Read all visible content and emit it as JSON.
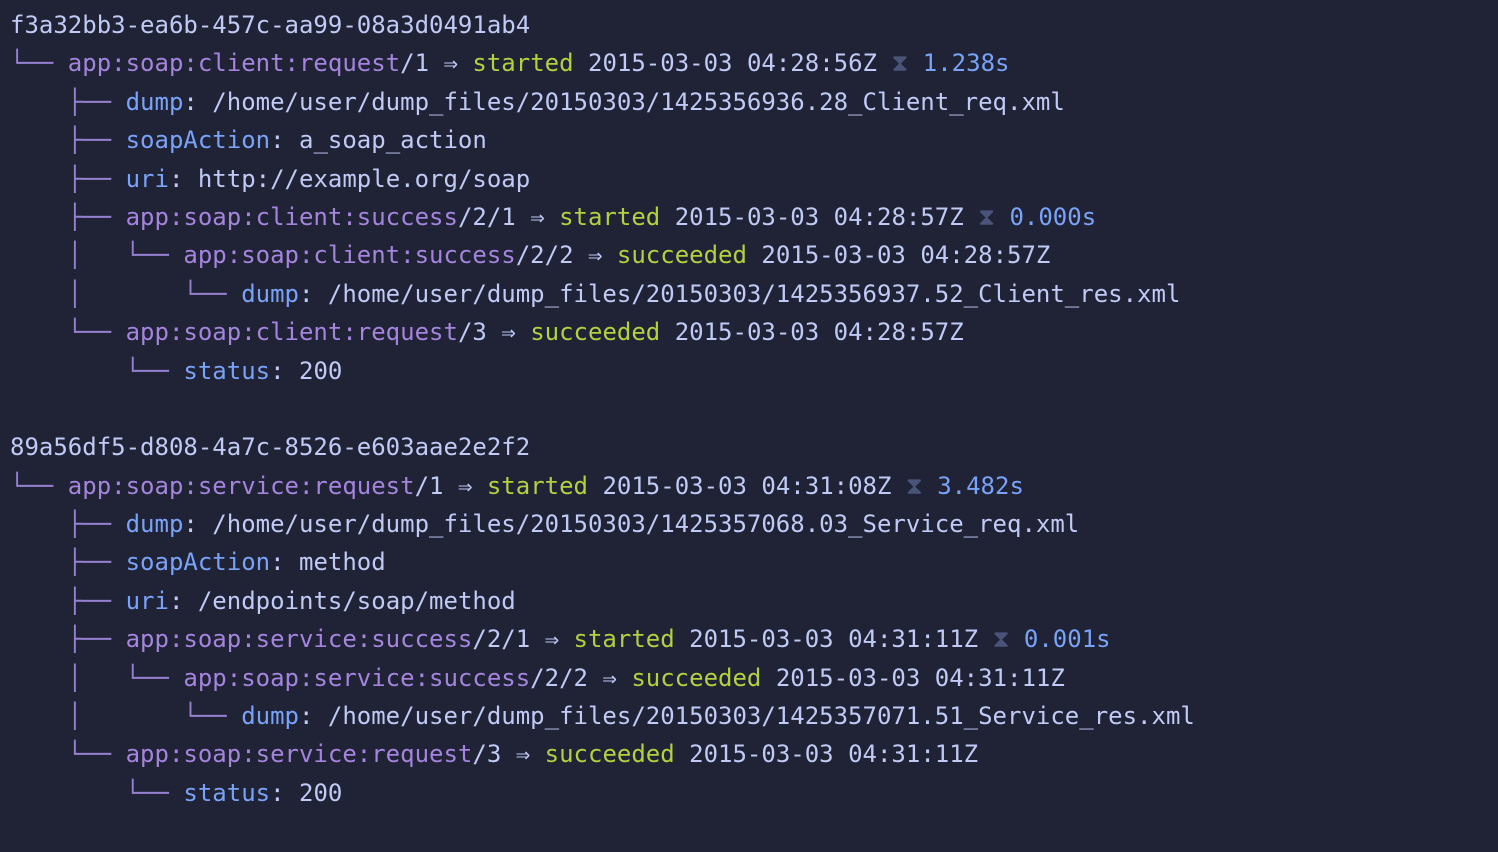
{
  "groups": [
    {
      "uuid": "f3a32bb3-ea6b-457c-aa99-08a3d0491ab4",
      "lines": [
        {
          "type": "event",
          "tree": "└── ",
          "name": "app:soap:client:request",
          "suffix": "/1",
          "state": "started",
          "ts": "2015-03-03 04:28:56Z",
          "hourglass": "⧗",
          "dur": "1.238s"
        },
        {
          "type": "attr",
          "tree": "    ├── ",
          "key": "dump",
          "val": "/home/user/dump_files/20150303/1425356936.28_Client_req.xml"
        },
        {
          "type": "attr",
          "tree": "    ├── ",
          "key": "soapAction",
          "val": "a_soap_action"
        },
        {
          "type": "attr",
          "tree": "    ├── ",
          "key": "uri",
          "val": "http://example.org/soap"
        },
        {
          "type": "event",
          "tree": "    ├── ",
          "name": "app:soap:client:success",
          "suffix": "/2/1",
          "state": "started",
          "ts": "2015-03-03 04:28:57Z",
          "hourglass": "⧗",
          "dur": "0.000s"
        },
        {
          "type": "event",
          "tree": "    │   └── ",
          "name": "app:soap:client:success",
          "suffix": "/2/2",
          "state": "succeeded",
          "ts": "2015-03-03 04:28:57Z"
        },
        {
          "type": "attr",
          "tree": "    │       └── ",
          "key": "dump",
          "val": "/home/user/dump_files/20150303/1425356937.52_Client_res.xml"
        },
        {
          "type": "event",
          "tree": "    └── ",
          "name": "app:soap:client:request",
          "suffix": "/3",
          "state": "succeeded",
          "ts": "2015-03-03 04:28:57Z"
        },
        {
          "type": "attr",
          "tree": "        └── ",
          "key": "status",
          "val": "200"
        }
      ]
    },
    {
      "uuid": "89a56df5-d808-4a7c-8526-e603aae2e2f2",
      "lines": [
        {
          "type": "event",
          "tree": "└── ",
          "name": "app:soap:service:request",
          "suffix": "/1",
          "state": "started",
          "ts": "2015-03-03 04:31:08Z",
          "hourglass": "⧗",
          "dur": "3.482s"
        },
        {
          "type": "attr",
          "tree": "    ├── ",
          "key": "dump",
          "val": "/home/user/dump_files/20150303/1425357068.03_Service_req.xml"
        },
        {
          "type": "attr",
          "tree": "    ├── ",
          "key": "soapAction",
          "val": "method"
        },
        {
          "type": "attr",
          "tree": "    ├── ",
          "key": "uri",
          "val": "/endpoints/soap/method"
        },
        {
          "type": "event",
          "tree": "    ├── ",
          "name": "app:soap:service:success",
          "suffix": "/2/1",
          "state": "started",
          "ts": "2015-03-03 04:31:11Z",
          "hourglass": "⧗",
          "dur": "0.001s"
        },
        {
          "type": "event",
          "tree": "    │   └── ",
          "name": "app:soap:service:success",
          "suffix": "/2/2",
          "state": "succeeded",
          "ts": "2015-03-03 04:31:11Z"
        },
        {
          "type": "attr",
          "tree": "    │       └── ",
          "key": "dump",
          "val": "/home/user/dump_files/20150303/1425357071.51_Service_res.xml"
        },
        {
          "type": "event",
          "tree": "    └── ",
          "name": "app:soap:service:request",
          "suffix": "/3",
          "state": "succeeded",
          "ts": "2015-03-03 04:31:11Z"
        },
        {
          "type": "attr",
          "tree": "        └── ",
          "key": "status",
          "val": "200"
        }
      ]
    }
  ]
}
